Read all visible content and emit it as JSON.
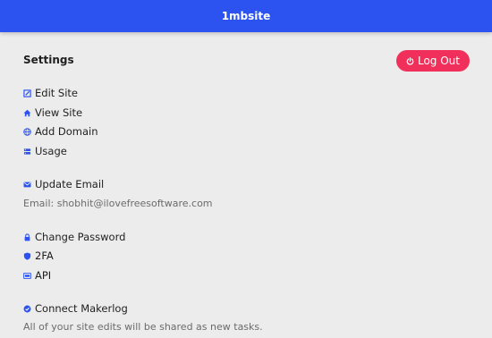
{
  "header": {
    "title": "1mbsite",
    "bg_color": "#2c53f0"
  },
  "settings": {
    "title": "Settings"
  },
  "logout": {
    "label": "Log Out",
    "icon": "power-icon",
    "color": "#f0305a"
  },
  "site_menu": [
    {
      "label": "Edit Site",
      "icon": "edit-icon"
    },
    {
      "label": "View Site",
      "icon": "home-icon"
    },
    {
      "label": "Add Domain",
      "icon": "globe-icon"
    },
    {
      "label": "Usage",
      "icon": "usage-icon"
    }
  ],
  "email": {
    "update_label": "Update Email",
    "icon": "mail-icon",
    "current_text": "Email: shobhit@ilovefreesoftware.com"
  },
  "security_menu": [
    {
      "label": "Change Password",
      "icon": "lock-icon"
    },
    {
      "label": "2FA",
      "icon": "shield-icon"
    },
    {
      "label": "API",
      "icon": "api-icon"
    }
  ],
  "makerlog": {
    "label": "Connect Makerlog",
    "icon": "check-circle-icon",
    "description": "All of your site edits will be shared as new tasks."
  },
  "accent_icon_color": "#2c53f0"
}
